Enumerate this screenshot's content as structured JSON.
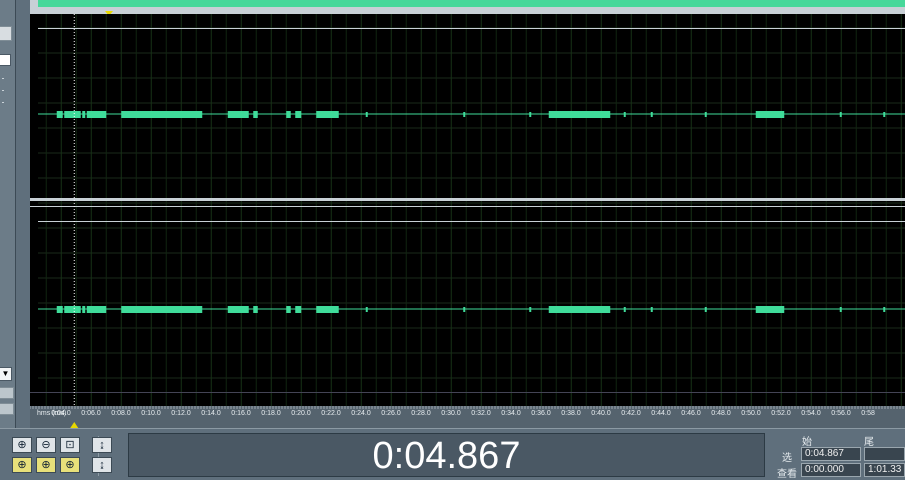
{
  "current_time": "0:04.867",
  "timeline": {
    "unit_label": "hms (ms)",
    "ticks": [
      "0:04.0",
      "0:06.0",
      "0:08.0",
      "0:10.0",
      "0:12.0",
      "0:14.0",
      "0:16.0",
      "0:18.0",
      "0:20.0",
      "0:22.0",
      "0:24.0",
      "0:26.0",
      "0:28.0",
      "0:30.0",
      "0:32.0",
      "0:34.0",
      "0:36.0",
      "0:38.0",
      "0:40.0",
      "0:42.0",
      "0:44.0",
      "0:46.0",
      "0:48.0",
      "0:50.0",
      "0:52.0",
      "0:54.0",
      "0:56.0",
      "0:58"
    ],
    "cursor_time_s": 4.867
  },
  "selection": {
    "col_start": "始",
    "col_end": "尾",
    "row_select_label": "选",
    "row_view_label": "查看",
    "select_start": "0:04.867",
    "select_end": "",
    "view_start": "0:00.000",
    "view_end": "1:01.33"
  },
  "zoom_buttons": [
    {
      "name": "zoom-in-horizontal-button",
      "glyph": "⊕",
      "yellow": false
    },
    {
      "name": "zoom-out-horizontal-button",
      "glyph": "⊖",
      "yellow": false
    },
    {
      "name": "zoom-full-button",
      "glyph": "⊡",
      "yellow": false
    },
    {
      "name": "zoom-to-selection-button",
      "glyph": "⊕",
      "yellow": true
    },
    {
      "name": "zoom-left-button",
      "glyph": "⊕",
      "yellow": true
    },
    {
      "name": "zoom-right-button",
      "glyph": "⊕",
      "yellow": true
    },
    {
      "name": "zoom-in-vertical-button",
      "glyph": "↨",
      "yellow": false
    },
    {
      "name": "zoom-out-vertical-button",
      "glyph": "↨",
      "yellow": false
    }
  ],
  "colors": {
    "waveform": "#3fdc9a",
    "overview": "#47d89a",
    "cursor_marker": "#e8d800",
    "background": "#000000"
  },
  "waveform_segments_s": [
    [
      3.7,
      4.1
    ],
    [
      4.2,
      5.3
    ],
    [
      5.4,
      5.6
    ],
    [
      5.7,
      7.0
    ],
    [
      8.0,
      13.4
    ],
    [
      15.1,
      16.5
    ],
    [
      16.8,
      17.1
    ],
    [
      19.0,
      19.3
    ],
    [
      19.6,
      20.0
    ],
    [
      21.0,
      22.5
    ],
    [
      36.5,
      40.6
    ],
    [
      50.3,
      52.2
    ]
  ]
}
